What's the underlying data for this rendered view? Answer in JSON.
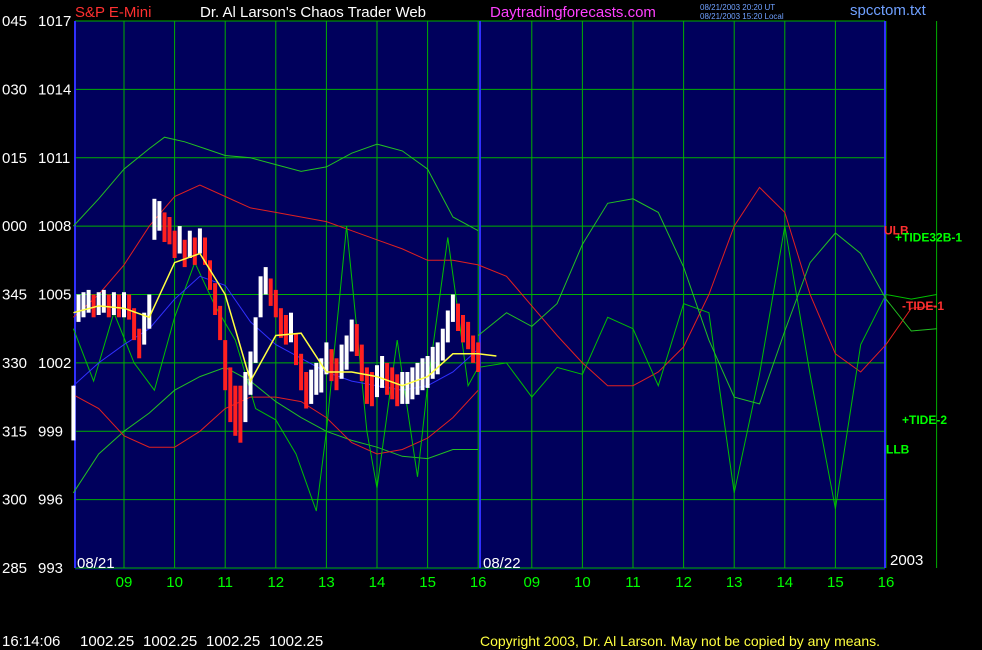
{
  "header": {
    "instrument": "S&P E-Mini",
    "title": "Dr. Al Larson's Chaos Trader Web",
    "site": "Daytradingforecasts.com",
    "timestamp_ut": "08/21/2003 20:20 UT",
    "timestamp_local": "08/21/2003 15:20 Local",
    "filename": "spcctom.txt"
  },
  "footer": {
    "time": "16:14:06",
    "ohlc": [
      "1002.25",
      "1002.25",
      "1002.25",
      "1002.25"
    ],
    "copyright": "Copyright 2003, Dr. Al Larson. May not be copied by any means."
  },
  "colors": {
    "background": "#000000",
    "plot_bg": "#00005c",
    "grid": "#00b000",
    "day_divider": "#3030ff",
    "instrument": "#ff3030",
    "title": "#ffffff",
    "site": "#ff40ff",
    "filename": "#6fa0ff",
    "axis_text": "#ffffff",
    "time_text": "#00ff00",
    "price_bar_up": "#ffffff",
    "price_bar_down": "#ff2020",
    "moving_avg": "#ffff40",
    "tide_green": "#00c000",
    "tide_red": "#e02020",
    "band_green": "#22c022",
    "blue_avg": "#3030ff"
  },
  "chart_data": {
    "type": "line",
    "y_axis": {
      "ylim": [
        993,
        1017
      ],
      "left_labels": [
        "045",
        "030",
        "015",
        "000",
        "345",
        "330",
        "315",
        "300",
        "285"
      ],
      "right_labels": [
        "1017",
        "1014",
        "1011",
        "1008",
        "1005",
        "1002",
        "999",
        "996",
        "993"
      ]
    },
    "x_axis": {
      "day_labels": [
        "08/21",
        "08/22"
      ],
      "year_label": "2003",
      "hour_labels": [
        "09",
        "10",
        "11",
        "12",
        "13",
        "14",
        "15",
        "16",
        "09",
        "10",
        "11",
        "12",
        "13",
        "14",
        "15",
        "16"
      ]
    },
    "annotations": [
      {
        "text": "ULB",
        "color": "#ff3030",
        "y": 1007.8
      },
      {
        "text": "+TIDE32B-1",
        "color": "#00ff00",
        "y": 1007.5
      },
      {
        "text": "-TIDE-1",
        "color": "#ff3030",
        "y": 1004.5
      },
      {
        "text": "+TIDE-2",
        "color": "#00ff00",
        "y": 999.5
      },
      {
        "text": "LLB",
        "color": "#00ff00",
        "y": 998.2
      }
    ],
    "series": [
      {
        "kind": "price_bars",
        "t": [
          8.0,
          8.1,
          8.2,
          8.3,
          8.4,
          8.5,
          8.6,
          8.7,
          8.8,
          8.9,
          9.0,
          9.1,
          9.2,
          9.3,
          9.4,
          9.5,
          9.6,
          9.7,
          9.8,
          9.9,
          10.0,
          10.1,
          10.2,
          10.3,
          10.4,
          10.5,
          10.6,
          10.7,
          10.8,
          10.9,
          11.0,
          11.1,
          11.2,
          11.3,
          11.4,
          11.5,
          11.6,
          11.7,
          11.8,
          11.9,
          12.0,
          12.1,
          12.2,
          12.3,
          12.4,
          12.5,
          12.6,
          12.7,
          12.8,
          12.9,
          13.0,
          13.1,
          13.2,
          13.3,
          13.4,
          13.5,
          13.6,
          13.7,
          13.8,
          13.9,
          14.0,
          14.1,
          14.2,
          14.3,
          14.4,
          14.5,
          14.6,
          14.7,
          14.8,
          14.9,
          15.0,
          15.1,
          15.2,
          15.3,
          15.4,
          15.5,
          15.6,
          15.7,
          15.8,
          15.9,
          16.0
        ],
        "close": [
          999.2,
          1004.4,
          1004.6,
          1004.8,
          1004.6,
          1004.7,
          1004.8,
          1004.6,
          1004.7,
          1004.6,
          1004.6,
          1004.5,
          1003.8,
          1002.8,
          1003.5,
          1004.2,
          1008.2,
          1008.6,
          1008.0,
          1007.8,
          1007.2,
          1007.4,
          1006.8,
          1007.2,
          1006.9,
          1007.4,
          1007.0,
          1005.9,
          1004.9,
          1003.8,
          1001.8,
          1000.6,
          999.9,
          999.6,
          1000.4,
          1001.5,
          1003.0,
          1004.8,
          1005.6,
          1005.1,
          1004.6,
          1003.8,
          1003.5,
          1003.6,
          1002.6,
          1001.6,
          1000.8,
          1000.9,
          1001.3,
          1001.4,
          1002.2,
          1001.9,
          1001.5,
          1002.0,
          1002.4,
          1003.2,
          1003.0,
          1002.0,
          1001.0,
          1000.9,
          1001.2,
          1001.6,
          1001.3,
          1001.1,
          1000.8,
          1000.9,
          1000.9,
          1001.1,
          1001.3,
          1001.5,
          1001.6,
          1002.0,
          1002.2,
          1002.8,
          1003.6,
          1004.4,
          1004.0,
          1003.5,
          1003.2,
          1002.6,
          1002.25
        ],
        "high": [
          1001.0,
          1005.0,
          1005.1,
          1005.2,
          1005.0,
          1005.1,
          1005.2,
          1005.0,
          1005.1,
          1005.0,
          1005.1,
          1005.0,
          1004.4,
          1003.5,
          1004.2,
          1005.0,
          1009.2,
          1009.1,
          1008.6,
          1008.4,
          1007.8,
          1008.0,
          1007.4,
          1007.8,
          1007.5,
          1007.9,
          1007.5,
          1006.5,
          1005.5,
          1004.5,
          1003.0,
          1001.8,
          1001.0,
          1001.0,
          1001.6,
          1002.5,
          1004.0,
          1005.8,
          1006.2,
          1005.7,
          1005.2,
          1004.4,
          1004.1,
          1004.2,
          1003.3,
          1002.4,
          1001.6,
          1001.7,
          1002.0,
          1002.2,
          1002.9,
          1002.6,
          1002.2,
          1002.8,
          1003.2,
          1003.9,
          1003.7,
          1002.8,
          1001.8,
          1001.6,
          1001.9,
          1002.3,
          1002.0,
          1001.8,
          1001.5,
          1001.6,
          1001.6,
          1001.8,
          1002.0,
          1002.2,
          1002.3,
          1002.7,
          1002.9,
          1003.5,
          1004.3,
          1005.0,
          1004.6,
          1004.1,
          1003.8,
          1003.2,
          1002.9
        ],
        "low": [
          998.6,
          1003.8,
          1004.0,
          1004.2,
          1004.0,
          1004.1,
          1004.2,
          1004.0,
          1004.1,
          1004.0,
          1004.0,
          1003.9,
          1003.0,
          1002.2,
          1002.8,
          1003.5,
          1007.4,
          1007.8,
          1007.3,
          1007.2,
          1006.6,
          1006.8,
          1006.2,
          1006.6,
          1006.3,
          1006.8,
          1006.3,
          1005.2,
          1004.1,
          1003.0,
          1000.8,
          999.4,
          998.8,
          998.5,
          999.4,
          1000.6,
          1002.0,
          1004.0,
          1005.0,
          1004.5,
          1004.0,
          1003.1,
          1002.8,
          1002.9,
          1001.9,
          1000.8,
          1000.0,
          1000.2,
          1000.6,
          1000.7,
          1001.5,
          1001.2,
          1000.8,
          1001.3,
          1001.7,
          1002.5,
          1002.3,
          1001.2,
          1000.2,
          1000.1,
          1000.5,
          1000.9,
          1000.6,
          1000.4,
          1000.1,
          1000.2,
          1000.2,
          1000.4,
          1000.6,
          1000.8,
          1000.9,
          1001.3,
          1001.5,
          1002.1,
          1002.9,
          1003.8,
          1003.4,
          1002.9,
          1002.6,
          1002.0,
          1001.6
        ]
      },
      {
        "kind": "moving_average",
        "t": [
          8.0,
          8.5,
          9.0,
          9.5,
          10.0,
          10.5,
          11.0,
          11.5,
          12.0,
          12.5,
          13.0,
          13.5,
          14.0,
          14.5,
          15.0,
          15.5,
          16.0,
          16.3
        ],
        "y": [
          1004.2,
          1004.5,
          1004.4,
          1004.0,
          1006.4,
          1006.8,
          1005.0,
          1001.2,
          1003.2,
          1003.3,
          1001.6,
          1001.6,
          1001.4,
          1001.0,
          1001.4,
          1002.4,
          1002.4,
          1002.3
        ]
      },
      {
        "kind": "blue_average",
        "t": [
          8.0,
          8.5,
          9.0,
          9.5,
          10.0,
          10.5,
          11.0,
          11.5,
          12.0,
          12.5,
          13.0,
          13.5,
          14.0,
          14.5,
          15.0,
          15.5,
          16.0
        ],
        "y": [
          1001.0,
          1002.0,
          1002.8,
          1003.5,
          1004.8,
          1005.8,
          1005.4,
          1003.8,
          1002.8,
          1002.2,
          1001.6,
          1001.2,
          1001.0,
          1000.8,
          1001.0,
          1001.6,
          1002.6
        ]
      },
      {
        "kind": "upper_band",
        "t": [
          8.0,
          8.5,
          9.0,
          9.5,
          9.8,
          10.2,
          10.6,
          11.0,
          11.5,
          12.0,
          12.5,
          13.0,
          13.5,
          14.0,
          14.5,
          15.0,
          15.5,
          16.0
        ],
        "y": [
          1008.0,
          1009.2,
          1010.5,
          1011.4,
          1011.9,
          1011.7,
          1011.4,
          1011.1,
          1011.0,
          1010.7,
          1010.4,
          1010.6,
          1011.2,
          1011.6,
          1011.3,
          1010.5,
          1008.4,
          1007.8
        ]
      },
      {
        "kind": "lower_band",
        "t": [
          8.0,
          8.5,
          9.0,
          9.5,
          10.0,
          10.5,
          11.0,
          11.5,
          12.0,
          12.5,
          13.0,
          13.5,
          14.0,
          14.5,
          15.0,
          15.5,
          16.0
        ],
        "y": [
          996.3,
          998.0,
          999.0,
          999.8,
          1000.8,
          1001.4,
          1001.8,
          1001.2,
          1000.3,
          999.6,
          999.0,
          998.6,
          998.3,
          997.9,
          997.8,
          998.2,
          998.2
        ]
      },
      {
        "kind": "red_band",
        "t": [
          8.0,
          8.5,
          9.0,
          9.5,
          10.0,
          10.5,
          11.0,
          11.5,
          12.0,
          12.5,
          13.0,
          13.5,
          14.0,
          14.5,
          15.0,
          15.5,
          16.0
        ],
        "y": [
          1000.6,
          1000.0,
          998.8,
          998.3,
          998.3,
          999.0,
          1000.0,
          1000.5,
          1000.5,
          1000.3,
          999.6,
          998.5,
          998.0,
          998.2,
          998.7,
          999.6,
          1000.8
        ]
      },
      {
        "kind": "tide_red",
        "t": [
          8.0,
          8.5,
          9.0,
          9.5,
          10.0,
          10.5,
          11.0,
          11.5,
          12.0,
          12.5,
          13.0,
          13.5,
          14.0,
          14.5,
          15.0,
          15.5,
          16.0,
          16.5,
          17.0,
          17.5,
          18.0,
          18.5,
          19.0,
          19.5,
          20.0,
          20.5,
          21.0,
          21.5,
          22.0,
          22.5,
          23.0,
          23.5,
          24.0,
          24.5,
          25.0
        ],
        "y": [
          1004.0,
          1005.0,
          1006.3,
          1008.0,
          1009.3,
          1009.8,
          1009.3,
          1008.8,
          1008.6,
          1008.4,
          1008.2,
          1007.8,
          1007.4,
          1007.0,
          1006.5,
          1006.5,
          1006.3,
          1005.8,
          1004.5,
          1003.2,
          1002.0,
          1001.0,
          1001.0,
          1001.6,
          1002.7,
          1005.0,
          1008.0,
          1009.7,
          1008.6,
          1005.0,
          1002.4,
          1001.6,
          1002.8,
          1004.4,
          1004.5
        ]
      },
      {
        "kind": "tide_green",
        "t": [
          8.0,
          8.4,
          8.8,
          9.2,
          9.6,
          10.0,
          10.4,
          10.8,
          11.2,
          11.6,
          12.0,
          12.4,
          12.8,
          13.0,
          13.4,
          13.8,
          14.0,
          14.4,
          14.8,
          15.0,
          15.4,
          15.8,
          16.0,
          16.5,
          17.0,
          17.5,
          18.0,
          18.5,
          19.0,
          19.5,
          20.0,
          20.5,
          21.0,
          21.5,
          22.0,
          22.5,
          23.0,
          23.5,
          24.0,
          24.5,
          25.0
        ],
        "y": [
          1003.5,
          1001.2,
          1004.2,
          1002.0,
          1000.8,
          1004.0,
          1006.4,
          1004.5,
          1003.0,
          1000.0,
          999.5,
          998.0,
          995.5,
          999.0,
          1008.0,
          999.0,
          996.5,
          1003.0,
          997.0,
          1001.0,
          1007.5,
          1001.0,
          1001.8,
          1002.0,
          1000.5,
          1001.8,
          1001.5,
          1004.0,
          1003.5,
          1001.0,
          1004.6,
          1004.2,
          996.3,
          1001.5,
          1008.0,
          1001.5,
          995.6,
          1002.8,
          1005.0,
          1004.8,
          1005.0
        ]
      },
      {
        "kind": "tide32b",
        "t": [
          16.0,
          16.5,
          17.0,
          17.5,
          18.0,
          18.5,
          19.0,
          19.5,
          20.0,
          20.5,
          21.0,
          21.5,
          22.0,
          22.5,
          23.0,
          23.5,
          24.0,
          24.5,
          25.0
        ],
        "y": [
          1003.2,
          1004.2,
          1003.6,
          1004.6,
          1007.2,
          1009.0,
          1009.2,
          1008.6,
          1006.2,
          1003.0,
          1000.5,
          1000.2,
          1003.4,
          1006.4,
          1007.7,
          1006.8,
          1004.8,
          1003.4,
          1003.5
        ]
      }
    ]
  }
}
